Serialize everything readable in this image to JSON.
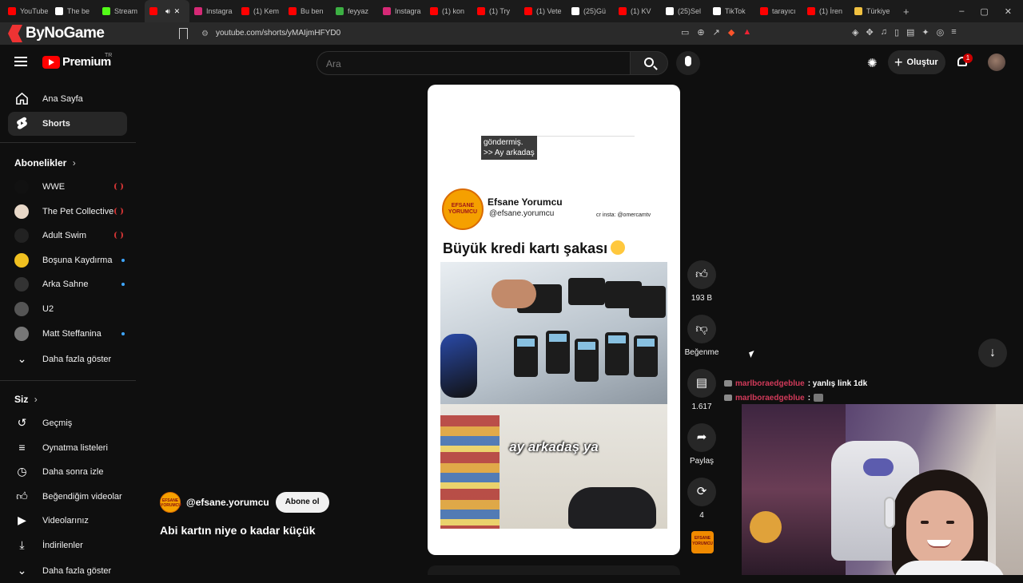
{
  "browser": {
    "tabs": [
      {
        "label": "YouTube",
        "color": "#ff0000",
        "active": false
      },
      {
        "label": "The be",
        "color": "#ffffff",
        "active": false
      },
      {
        "label": "Stream",
        "color": "#53fc18",
        "active": false
      },
      {
        "label": "",
        "color": "#ff0000",
        "active": true
      },
      {
        "label": "Instagra",
        "color": "#d62976",
        "active": false
      },
      {
        "label": "(1) Kem",
        "color": "#ff0000",
        "active": false
      },
      {
        "label": "Bu ben",
        "color": "#ff0000",
        "active": false
      },
      {
        "label": "feyyaz",
        "color": "#3cb043",
        "active": false
      },
      {
        "label": "Instagra",
        "color": "#d62976",
        "active": false
      },
      {
        "label": "(1) kon",
        "color": "#ff0000",
        "active": false
      },
      {
        "label": "(1) Try",
        "color": "#ff0000",
        "active": false
      },
      {
        "label": "(1) Vete",
        "color": "#ff0000",
        "active": false
      },
      {
        "label": "(25)Gü",
        "color": "#ffffff",
        "active": false
      },
      {
        "label": "(1) KV",
        "color": "#ff0000",
        "active": false
      },
      {
        "label": "(25)Sel",
        "color": "#ffffff",
        "active": false
      },
      {
        "label": "TikTok",
        "color": "#ffffff",
        "active": false
      },
      {
        "label": "tarayıcı",
        "color": "#ff0000",
        "active": false
      },
      {
        "label": "(1) İren",
        "color": "#ff0000",
        "active": false
      },
      {
        "label": "Türkiye",
        "color": "#f0c040",
        "active": false
      }
    ],
    "new_tab": "+",
    "window_controls": [
      "–",
      "▢",
      "✕"
    ],
    "brand": "ByNoGame",
    "url": "youtube.com/shorts/yMAIjmHFYD0"
  },
  "header": {
    "logo_text": "Premium",
    "region": "TR",
    "search_placeholder": "Ara",
    "create_label": "Oluştur",
    "notification_count": "1"
  },
  "sidebar": {
    "main": [
      {
        "label": "Ana Sayfa",
        "icon": "home-icon"
      },
      {
        "label": "Shorts",
        "icon": "shorts-icon"
      }
    ],
    "subscriptions_title": "Abonelikler",
    "subscriptions": [
      {
        "label": "WWE",
        "status": "live",
        "avatar_color": "#111111"
      },
      {
        "label": "The Pet Collective",
        "status": "live",
        "avatar_color": "#e8d8c8"
      },
      {
        "label": "Adult Swim",
        "status": "live",
        "avatar_color": "#222222"
      },
      {
        "label": "Boşuna Kaydırma",
        "status": "new",
        "avatar_color": "#f0c020"
      },
      {
        "label": "Arka Sahne",
        "status": "new",
        "avatar_color": "#333333"
      },
      {
        "label": "U2",
        "status": "",
        "avatar_color": "#555555"
      },
      {
        "label": "Matt Steffanina",
        "status": "new",
        "avatar_color": "#777777"
      }
    ],
    "show_more": "Daha fazla göster",
    "you_title": "Siz",
    "you_items": [
      {
        "label": "Geçmiş",
        "icon": "history-icon"
      },
      {
        "label": "Oynatma listeleri",
        "icon": "playlists-icon"
      },
      {
        "label": "Daha sonra izle",
        "icon": "watch-later-icon"
      },
      {
        "label": "Beğendiğim videolar",
        "icon": "liked-videos-icon"
      },
      {
        "label": "Videolarınız",
        "icon": "your-videos-icon"
      },
      {
        "label": "İndirilenler",
        "icon": "downloads-icon"
      }
    ],
    "you_show_more": "Daha fazla göster"
  },
  "short": {
    "prev_message_line1": "göndermiş.",
    "prev_message_line2": ">> Ay arkadaş",
    "account_name": "Efsane Yorumcu",
    "account_handle": "@efsane.yorumcu",
    "credit": "cr insta: @omercamtv",
    "post_title": "Büyük kredi kartı şakası",
    "logo_line1": "EFSANE",
    "logo_line2": "YORUMCU",
    "video_caption": "ay arkadaş ya",
    "channel_handle": "@efsane.yorumcu",
    "subscribe_label": "Abone ol",
    "title": "Abi kartın niye o kadar küçük"
  },
  "actions": {
    "like_count": "193 B",
    "dislike_label": "Beğenme",
    "comment_count": "1.617",
    "share_label": "Paylaş",
    "remix_count": "4"
  },
  "chat": [
    {
      "user": "marlboraedgeblue",
      "message": ": yanlış link 1dk",
      "emote": false
    },
    {
      "user": "marlboraedgeblue",
      "message": ":",
      "emote": true
    }
  ],
  "colors": {
    "background": "#0f0f0f",
    "brand_red": "#ff0000",
    "chat_user": "#d23a5a"
  }
}
